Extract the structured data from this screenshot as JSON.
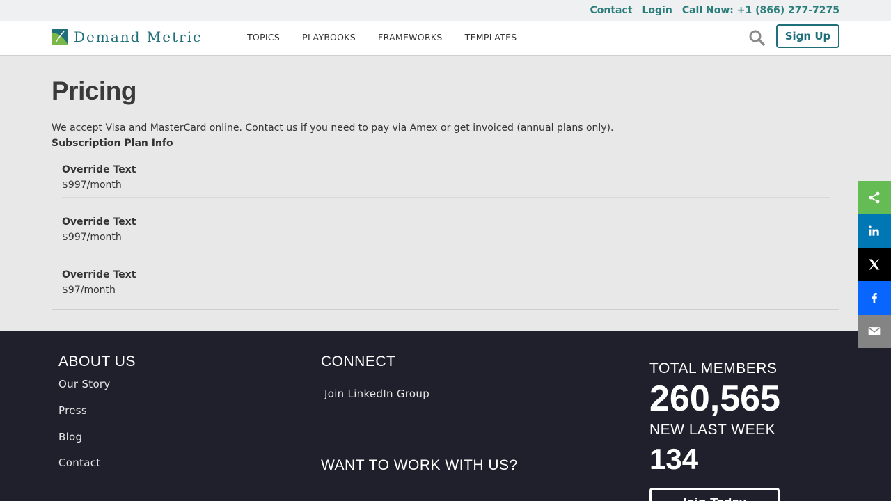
{
  "topbar": {
    "contact": "Contact",
    "login": "Login",
    "call": "Call Now: +1 (866) 277-7275"
  },
  "brand": {
    "name": "Demand Metric"
  },
  "nav": {
    "items": [
      {
        "label": "TOPICS"
      },
      {
        "label": "PLAYBOOKS"
      },
      {
        "label": "FRAMEWORKS"
      },
      {
        "label": "TEMPLATES"
      }
    ],
    "signup": "Sign Up",
    "search_icon": "search-icon"
  },
  "page": {
    "title": "Pricing",
    "intro": "We accept Visa and MasterCard online. Contact us if you need to pay via Amex or get invoiced (annual plans only).",
    "plan_info_label": "Subscription Plan Info",
    "plans": [
      {
        "name": "Override Text",
        "price": "$997/month"
      },
      {
        "name": "Override Text",
        "price": "$997/month"
      },
      {
        "name": "Override Text",
        "price": "$97/month"
      }
    ]
  },
  "footer": {
    "about": {
      "heading": "ABOUT US",
      "links": [
        "Our Story",
        "Press",
        "Blog",
        "Contact"
      ]
    },
    "connect": {
      "heading": "CONNECT",
      "link": "Join LinkedIn Group"
    },
    "work": {
      "heading": "WANT TO WORK WITH US?"
    },
    "stats": {
      "total_label": "TOTAL MEMBERS",
      "total_value": "260,565",
      "new_label": "NEW LAST WEEK",
      "new_value": "134",
      "join_button": "Join Today"
    }
  },
  "share": {
    "buttons": [
      {
        "icon": "share-icon",
        "color": "#65bc54"
      },
      {
        "icon": "linkedin-icon",
        "color": "#0077b5"
      },
      {
        "icon": "x-twitter-icon",
        "color": "#000000"
      },
      {
        "icon": "facebook-icon",
        "color": "#0866ff"
      },
      {
        "icon": "email-icon",
        "color": "#848484"
      }
    ]
  },
  "colors": {
    "accent": "#2b7d7a",
    "brand_teal": "#1f6f7a",
    "footer_bg": "#20202c",
    "page_bg": "#e8e8e8"
  }
}
